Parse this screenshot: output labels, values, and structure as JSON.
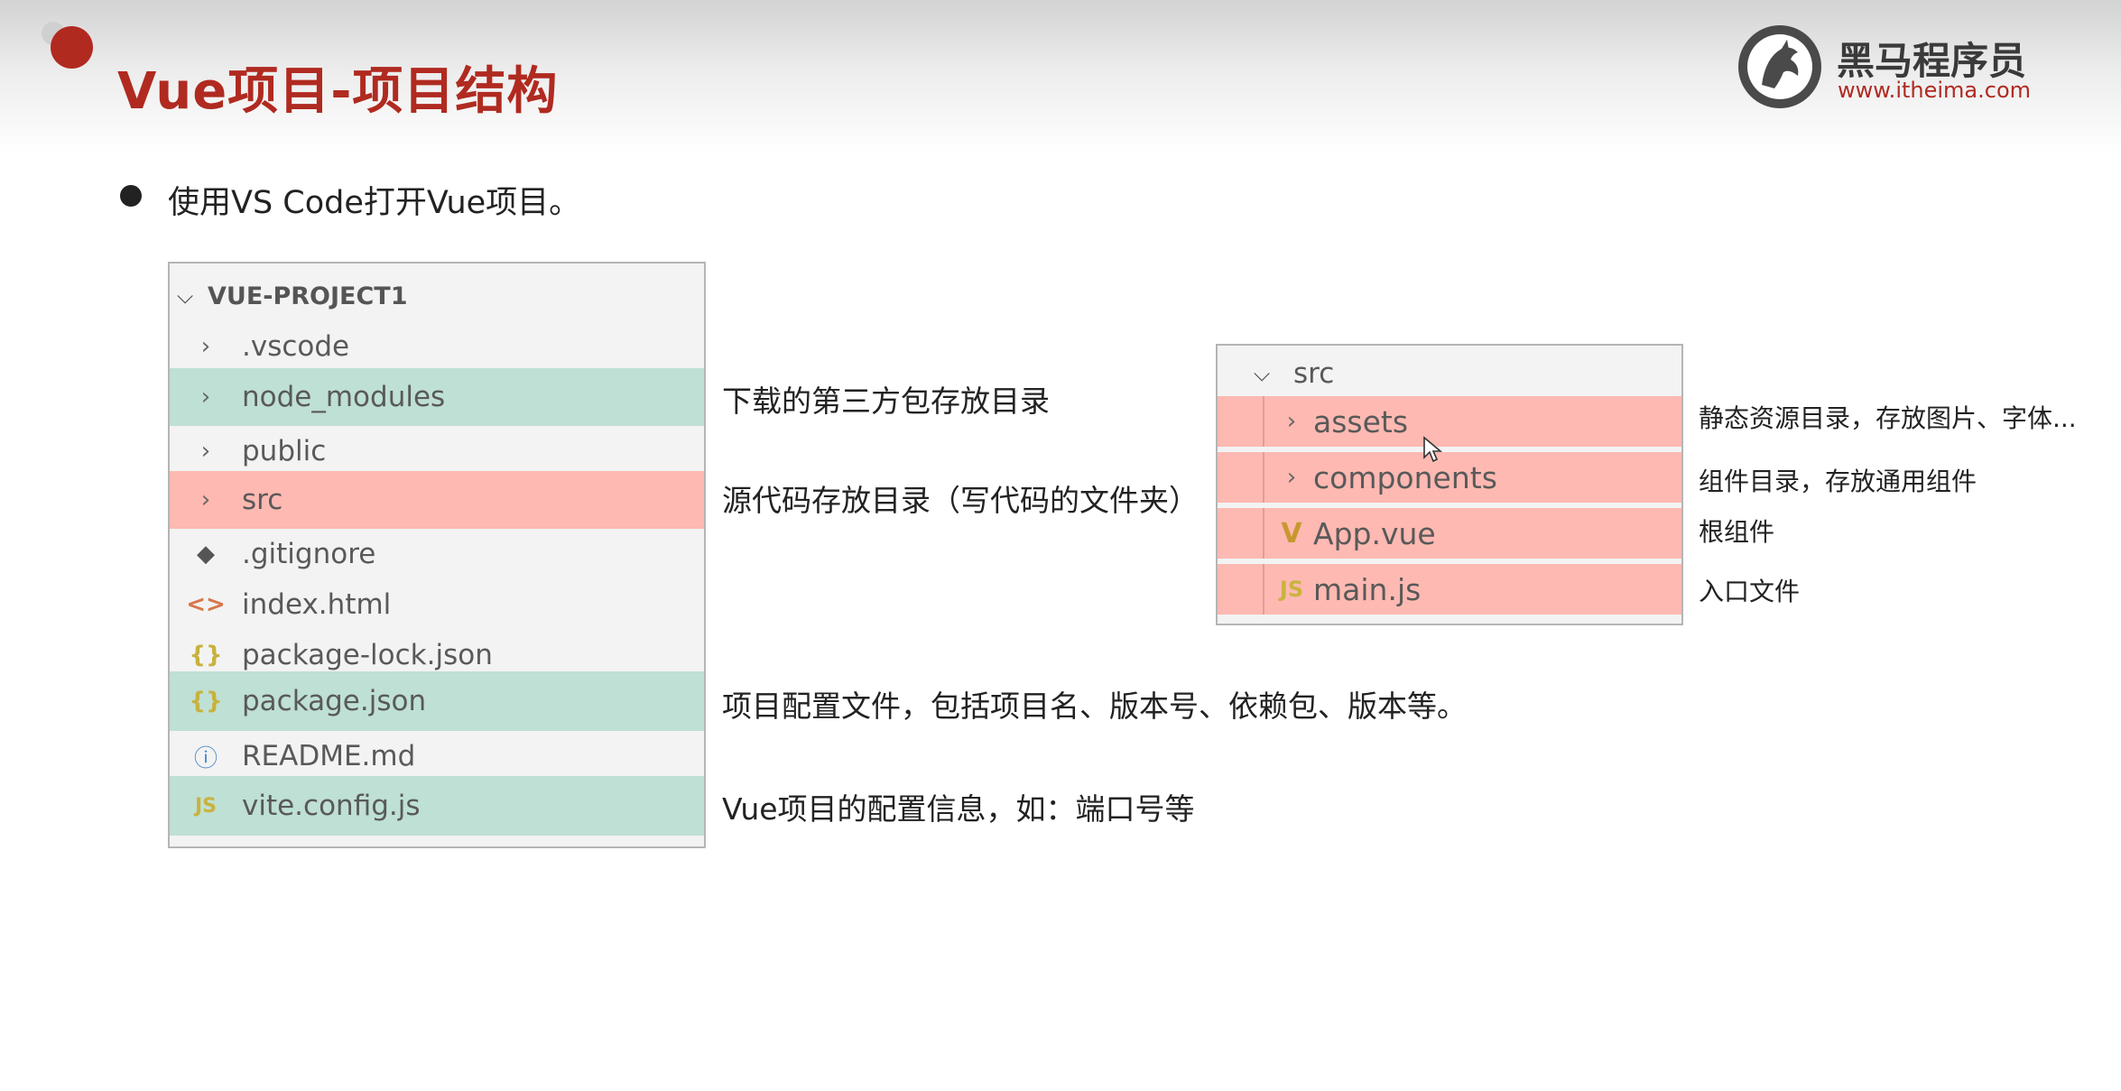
{
  "slide": {
    "title": "Vue项目-项目结构",
    "bullet": "使用VS  Code打开Vue项目。"
  },
  "logo": {
    "name_cn": "黑马程序员",
    "url": "www.itheima.com"
  },
  "explorer": {
    "project_name": "VUE-PROJECT1",
    "items": [
      {
        "label": ".vscode",
        "icon": "chevron-right-icon",
        "highlight": "none"
      },
      {
        "label": "node_modules",
        "icon": "chevron-right-icon",
        "highlight": "green"
      },
      {
        "label": "public",
        "icon": "chevron-right-icon",
        "highlight": "none"
      },
      {
        "label": "src",
        "icon": "chevron-right-icon",
        "highlight": "red"
      },
      {
        "label": ".gitignore",
        "icon": "git-icon",
        "highlight": "none"
      },
      {
        "label": "index.html",
        "icon": "html-icon",
        "highlight": "none"
      },
      {
        "label": "package-lock.json",
        "icon": "json-icon",
        "highlight": "none"
      },
      {
        "label": "package.json",
        "icon": "json-icon",
        "highlight": "green"
      },
      {
        "label": "README.md",
        "icon": "info-icon",
        "highlight": "none"
      },
      {
        "label": "vite.config.js",
        "icon": "js-icon",
        "highlight": "green"
      }
    ],
    "icon_glyphs": {
      "js": "JS",
      "json": "{}",
      "html": "<>"
    }
  },
  "annotations": {
    "node_modules": "下载的第三方包存放目录",
    "src": "源代码存放目录（写代码的文件夹）",
    "package_json": "项目配置文件，包括项目名、版本号、依赖包、版本等。",
    "vite_config": "Vue项目的配置信息，如：端口号等"
  },
  "src_panel": {
    "folder": "src",
    "items": [
      {
        "label": "assets",
        "icon": "chevron-right-icon"
      },
      {
        "label": "components",
        "icon": "chevron-right-icon"
      },
      {
        "label": "App.vue",
        "icon": "vue-icon"
      },
      {
        "label": "main.js",
        "icon": "js-icon"
      }
    ],
    "annotations": {
      "assets": "静态资源目录，存放图片、字体...",
      "components": "组件目录，存放通用组件",
      "app_vue": "根组件",
      "main_js": "入口文件"
    }
  },
  "colors": {
    "accent_red": "#b02a20",
    "highlight_green": "#bfe0d4",
    "highlight_red": "#fdb9b2"
  }
}
